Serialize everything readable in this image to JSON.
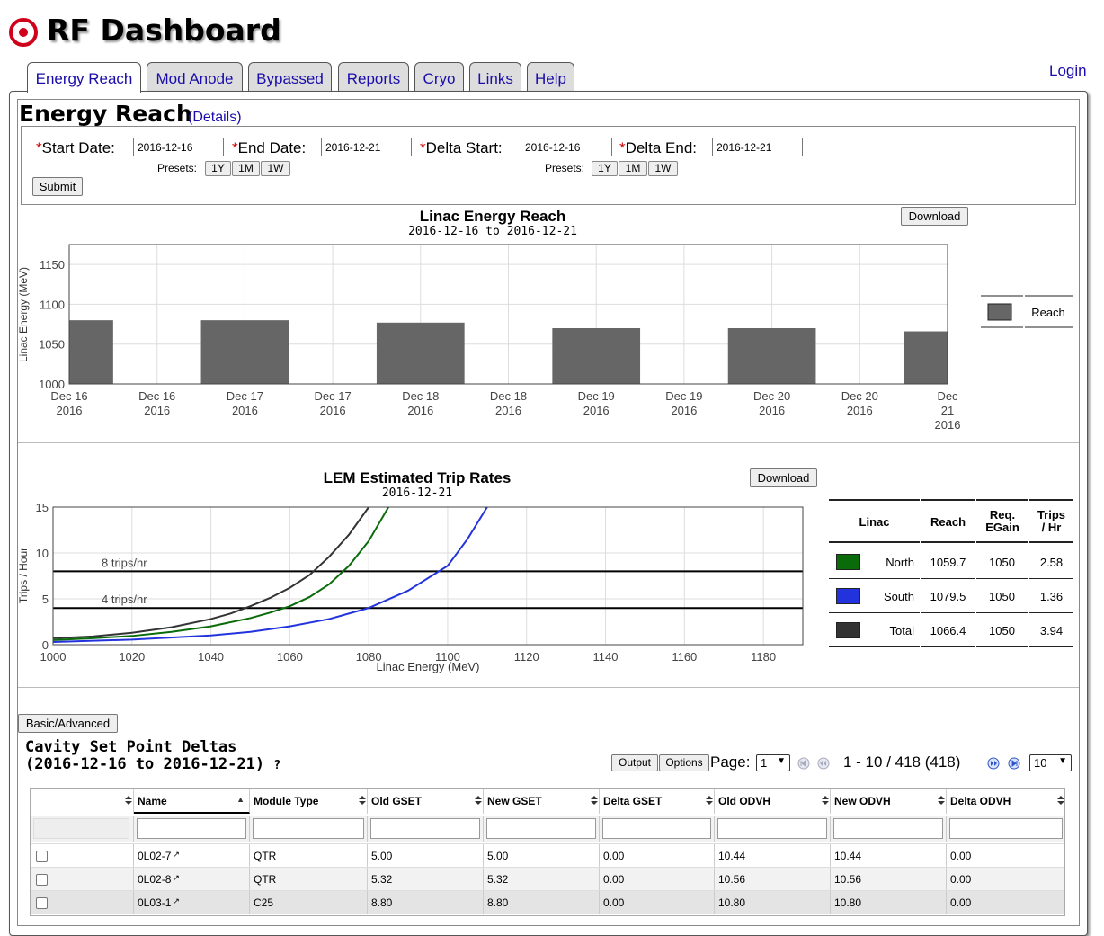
{
  "app": {
    "title": "RF Dashboard",
    "login": "Login"
  },
  "tabs": [
    {
      "label": "Energy Reach",
      "active": true
    },
    {
      "label": "Mod Anode"
    },
    {
      "label": "Bypassed"
    },
    {
      "label": "Reports"
    },
    {
      "label": "Cryo"
    },
    {
      "label": "Links"
    },
    {
      "label": "Help"
    }
  ],
  "page": {
    "title": "Energy Reach",
    "details_link": "Details"
  },
  "form": {
    "start_label": "Start Date:",
    "start_value": "2016-12-16",
    "end_label": "End Date:",
    "end_value": "2016-12-21",
    "delta_start_label": "Delta Start:",
    "delta_start_value": "2016-12-16",
    "delta_end_label": "Delta End:",
    "delta_end_value": "2016-12-21",
    "required_mark": "*",
    "presets_label": "Presets:",
    "presets": [
      "1Y",
      "1M",
      "1W"
    ],
    "submit": "Submit"
  },
  "download_label": "Download",
  "chart_data": [
    {
      "type": "bar",
      "title": "Linac Energy Reach",
      "subtitle": "2016-12-16 to 2016-12-21",
      "ylabel": "Linac Energy (MeV)",
      "ylim": [
        1000,
        1175
      ],
      "yticks": [
        1000,
        1050,
        1100,
        1150
      ],
      "xticks": [
        "Dec 16 2016",
        "Dec 16 2016",
        "Dec 17 2016",
        "Dec 17 2016",
        "Dec 18 2016",
        "Dec 18 2016",
        "Dec 19 2016",
        "Dec 19 2016",
        "Dec 20 2016",
        "Dec 20 2016",
        "Dec 21 2016"
      ],
      "categories": [
        "2016-12-16",
        "2016-12-17",
        "2016-12-18",
        "2016-12-19",
        "2016-12-20",
        "2016-12-21"
      ],
      "series": [
        {
          "name": "Reach",
          "values": [
            1080,
            1080,
            1077,
            1070,
            1070,
            1066
          ],
          "color": "#666666"
        }
      ],
      "legend": "right",
      "grid": true
    },
    {
      "type": "line",
      "title": "LEM Estimated Trip Rates",
      "subtitle": "2016-12-21",
      "xlabel": "Linac Energy (MeV)",
      "ylabel": "Trips / Hour",
      "xlim": [
        1000,
        1190
      ],
      "ylim": [
        0,
        15
      ],
      "xticks": [
        1000,
        1020,
        1040,
        1060,
        1080,
        1100,
        1120,
        1140,
        1160,
        1180
      ],
      "yticks": [
        0,
        5,
        10,
        15
      ],
      "reference_lines": [
        {
          "y": 8,
          "label": "8 trips/hr"
        },
        {
          "y": 4,
          "label": "4 trips/hr"
        }
      ],
      "grid": true,
      "series": [
        {
          "name": "Total",
          "color": "#333333",
          "x": [
            1000,
            1010,
            1020,
            1030,
            1040,
            1045,
            1050,
            1055,
            1060,
            1065,
            1070,
            1075,
            1080
          ],
          "y": [
            0.7,
            0.9,
            1.3,
            1.9,
            2.8,
            3.4,
            4.2,
            5.1,
            6.2,
            7.6,
            9.6,
            12.0,
            15.0
          ]
        },
        {
          "name": "North",
          "color": "#0a6b0a",
          "x": [
            1000,
            1010,
            1020,
            1030,
            1040,
            1050,
            1055,
            1060,
            1065,
            1070,
            1075,
            1080,
            1085
          ],
          "y": [
            0.5,
            0.7,
            0.95,
            1.4,
            2.0,
            2.9,
            3.5,
            4.2,
            5.2,
            6.6,
            8.6,
            11.3,
            15.0
          ]
        },
        {
          "name": "South",
          "color": "#2233dd",
          "x": [
            1000,
            1020,
            1040,
            1050,
            1060,
            1070,
            1080,
            1090,
            1100,
            1105,
            1110
          ],
          "y": [
            0.3,
            0.55,
            1.0,
            1.4,
            2.0,
            2.8,
            4.0,
            5.9,
            8.6,
            11.5,
            15.0
          ]
        }
      ]
    }
  ],
  "trip_table": {
    "headers": [
      "Linac",
      "Reach",
      "Req. EGain",
      "Trips / Hr"
    ],
    "rows": [
      {
        "linac": "North",
        "reach": "1059.7",
        "egain": "1050",
        "trips": "2.58",
        "color": "#0a6b0a"
      },
      {
        "linac": "South",
        "reach": "1079.5",
        "egain": "1050",
        "trips": "1.36",
        "color": "#2233dd"
      },
      {
        "linac": "Total",
        "reach": "1066.4",
        "egain": "1050",
        "trips": "3.94",
        "color": "#333333"
      }
    ]
  },
  "basic_advanced": "Basic/Advanced",
  "cavity": {
    "title_line1": "Cavity Set Point Deltas",
    "title_line2": "(2016-12-16 to 2016-12-21)",
    "help_mark": "?",
    "output_btn": "Output",
    "options_btn": "Options",
    "page_label": "Page:",
    "page_value": "1",
    "range_text": "1 - 10 / 418 (418)",
    "per_page": "10",
    "columns": [
      "",
      "Name",
      "Module Type",
      "Old GSET",
      "New GSET",
      "Delta GSET",
      "Old ODVH",
      "New ODVH",
      "Delta ODVH"
    ],
    "rows": [
      [
        "0L02-7",
        "QTR",
        "5.00",
        "5.00",
        "0.00",
        "10.44",
        "10.44",
        "0.00"
      ],
      [
        "0L02-8",
        "QTR",
        "5.32",
        "5.32",
        "0.00",
        "10.56",
        "10.56",
        "0.00"
      ],
      [
        "0L03-1",
        "C25",
        "8.80",
        "8.80",
        "0.00",
        "10.80",
        "10.80",
        "0.00"
      ]
    ]
  }
}
